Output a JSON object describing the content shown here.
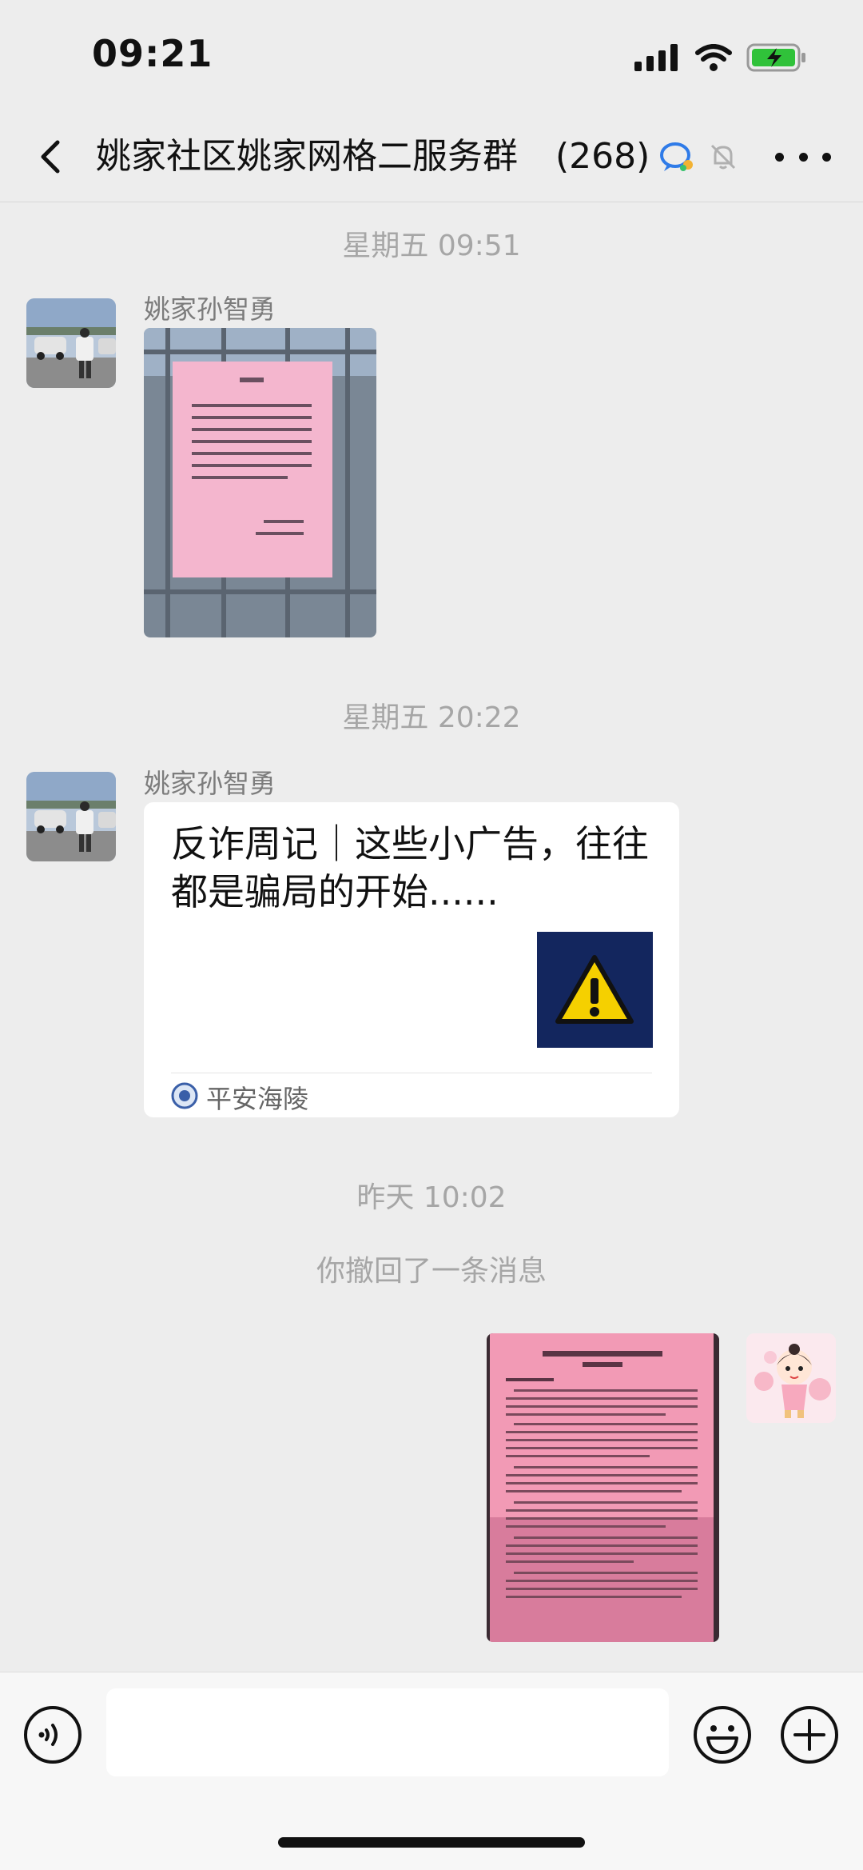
{
  "status_bar": {
    "time": "09:21"
  },
  "nav": {
    "title": "姚家社区姚家网格二服务群",
    "member_count": "(268)"
  },
  "messages": [
    {
      "timestamp": "星期五 09:51",
      "sender": "姚家孙智勇",
      "type": "image"
    },
    {
      "timestamp": "星期五 20:22",
      "sender": "姚家孙智勇",
      "type": "link-card",
      "card_title": "反诈周记｜这些小广告，往往都是骗局的开始......",
      "card_source": "平安海陵"
    },
    {
      "timestamp": "昨天 10:02",
      "recall_notice": "你撤回了一条消息",
      "type": "image"
    }
  ],
  "colors": {
    "accent": "#07C160",
    "background": "#EDEDED",
    "card": "#FFFFFF"
  }
}
